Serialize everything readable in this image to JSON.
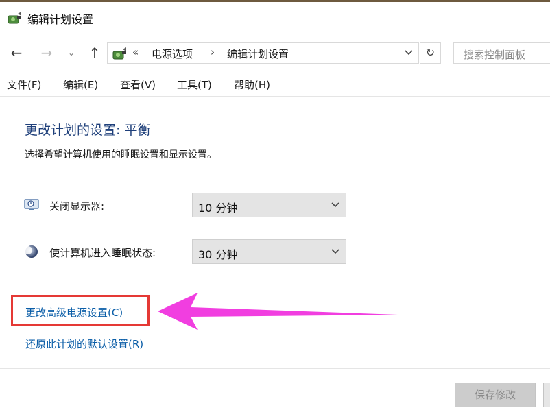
{
  "window": {
    "title": "编辑计划设置"
  },
  "nav": {
    "back_icon": "←",
    "forward_icon": "→",
    "recent_icon": "⌄",
    "up_icon": "↑"
  },
  "address": {
    "overflow": "«",
    "crumbs": [
      "电源选项",
      "编辑计划设置"
    ],
    "separator": "›",
    "refresh_icon": "↻"
  },
  "search": {
    "placeholder": "搜索控制面板"
  },
  "menu": {
    "items": [
      "文件(F)",
      "编辑(E)",
      "查看(V)",
      "工具(T)",
      "帮助(H)"
    ]
  },
  "main": {
    "heading": "更改计划的设置: 平衡",
    "subtitle": "选择希望计算机使用的睡眠设置和显示设置。",
    "settings": [
      {
        "label": "关闭显示器:",
        "value": "10 分钟",
        "icon": "display-off-icon"
      },
      {
        "label": "使计算机进入睡眠状态:",
        "value": "30 分钟",
        "icon": "sleep-moon-icon"
      }
    ],
    "links": {
      "advanced": "更改高级电源设置(C)",
      "restore": "还原此计划的默认设置(R)"
    }
  },
  "footer": {
    "save_label": "保存修改"
  },
  "colors": {
    "heading": "#1e3f7a",
    "link": "#0b5ea8",
    "highlight": "#e53935",
    "annotation_arrow": "#f13ee0"
  }
}
